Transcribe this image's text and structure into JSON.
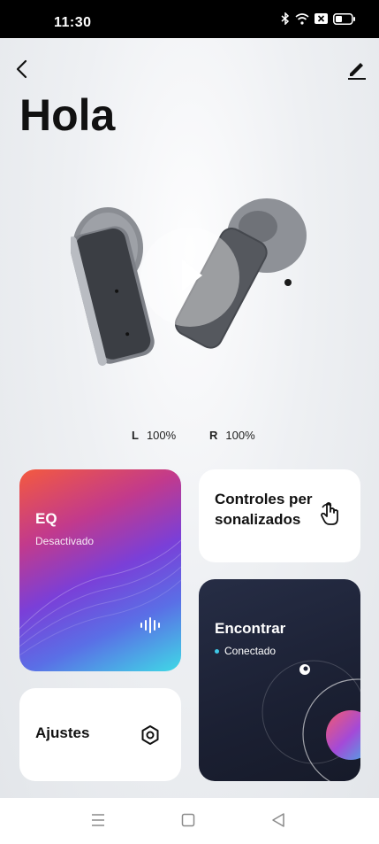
{
  "status_bar": {
    "time": "11:30",
    "icons": [
      "bluetooth-icon",
      "wifi-icon",
      "sim-icon",
      "battery-icon"
    ]
  },
  "header": {
    "title": "Hola",
    "back_icon": "back-arrow-icon",
    "edit_icon": "edit-icon"
  },
  "device": {
    "play_icon": "play-icon",
    "left": {
      "side": "L",
      "level": "100%"
    },
    "right": {
      "side": "R",
      "level": "100%"
    }
  },
  "cards": {
    "eq": {
      "label": "EQ",
      "status": "Desactivado",
      "icon": "sound-wave-icon"
    },
    "custom_controls": {
      "label": "Controles per sonalizados",
      "icon": "touch-hand-icon"
    },
    "find": {
      "label": "Encontrar",
      "status": "Conectado",
      "icon": "radar-icon"
    },
    "settings": {
      "label": "Ajustes",
      "icon": "settings-icon"
    }
  },
  "navbar": {
    "icons": [
      "menu-icon",
      "home-icon",
      "back-icon"
    ]
  },
  "colors": {
    "eq_gradient": [
      "#f45a3e",
      "#7a3fd8",
      "#3fd9e6"
    ],
    "find_bg": "#1b2033",
    "status_dot": "#3fc8e6"
  }
}
